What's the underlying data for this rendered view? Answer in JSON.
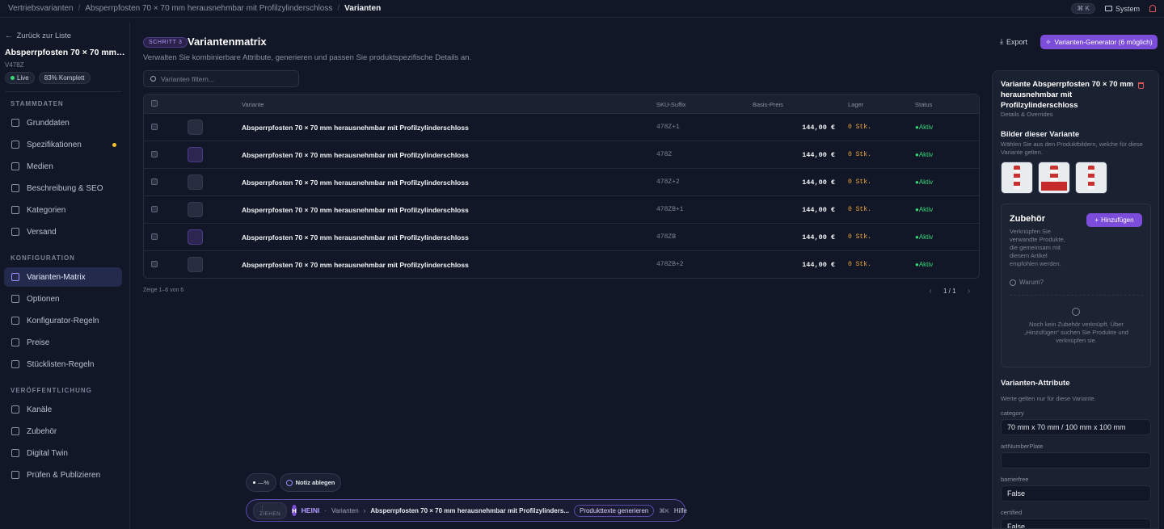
{
  "breadcrumb": {
    "items": [
      "Vertriebsvarianten",
      "Absperrpfosten 70 × 70 mm herausnehmbar mit Profilzylinderschloss",
      "Varianten"
    ]
  },
  "topbar": {
    "shortcut": "⌘ K",
    "theme_label": "System"
  },
  "sidebar": {
    "back_label": "Zurück zur Liste",
    "product_name": "Absperrpfosten 70 × 70 mm he...",
    "sku": "V478Z",
    "status_label": "Live",
    "complete_label": "83% Komplett",
    "sections": [
      {
        "title": "STAMMDATEN",
        "items": [
          "Grunddaten",
          "Spezifikationen",
          "Medien",
          "Beschreibung & SEO",
          "Kategorien",
          "Versand"
        ]
      },
      {
        "title": "KONFIGURATION",
        "items": [
          "Varianten-Matrix",
          "Optionen",
          "Konfigurator-Regeln",
          "Preise",
          "Stücklisten-Regeln"
        ]
      },
      {
        "title": "VERÖFFENTLICHUNG",
        "items": [
          "Kanäle",
          "Zubehör",
          "Digital Twin",
          "Prüfen & Publizieren"
        ]
      }
    ]
  },
  "main": {
    "step_label": "SCHRITT 3",
    "title": "Variantenmatrix",
    "subtitle": "Verwalten Sie kombinierbare Attribute, generieren und passen Sie produktspezifische Details an.",
    "export_label": "Export",
    "generator_label": "Varianten-Generator (6 möglich)",
    "filter_placeholder": "Varianten filtern...",
    "table": {
      "headers": {
        "variant": "Variante",
        "sku": "SKU-Suffix",
        "price": "Basis-Preis",
        "stock": "Lager",
        "status": "Status"
      },
      "rows": [
        {
          "name": "Absperrpfosten 70 × 70 mm herausnehmbar mit Profilzylinderschloss",
          "sku": "478Z+1",
          "price": "144,00 €",
          "stock": "0 Stk.",
          "status": "Aktiv"
        },
        {
          "name": "Absperrpfosten 70 × 70 mm herausnehmbar mit Profilzylinderschloss",
          "sku": "478Z",
          "price": "144,00 €",
          "stock": "0 Stk.",
          "status": "Aktiv"
        },
        {
          "name": "Absperrpfosten 70 × 70 mm herausnehmbar mit Profilzylinderschloss",
          "sku": "478Z+2",
          "price": "144,00 €",
          "stock": "0 Stk.",
          "status": "Aktiv"
        },
        {
          "name": "Absperrpfosten 70 × 70 mm herausnehmbar mit Profilzylinderschloss",
          "sku": "478ZB+1",
          "price": "144,00 €",
          "stock": "0 Stk.",
          "status": "Aktiv"
        },
        {
          "name": "Absperrpfosten 70 × 70 mm herausnehmbar mit Profilzylinderschloss",
          "sku": "478ZB",
          "price": "144,00 €",
          "stock": "0 Stk.",
          "status": "Aktiv"
        },
        {
          "name": "Absperrpfosten 70 × 70 mm herausnehmbar mit Profilzylinderschloss",
          "sku": "478ZB+2",
          "price": "144,00 €",
          "stock": "0 Stk.",
          "status": "Aktiv"
        }
      ]
    },
    "count_label": "Zeige 1–6 von 6",
    "page_label": "1 / 1"
  },
  "panel": {
    "title": "Variante Absperrpfosten 70 × 70 mm herausnehmbar mit Profilzylinderschloss",
    "subtitle": "Details & Overrides",
    "images_heading": "Bilder dieser Variante",
    "images_note": "Wählen Sie aus den Produktbildern, welche für diese Variante gelten.",
    "accessory": {
      "title": "Zubehör",
      "add_label": "Hinzufügen",
      "description": "Verknüpfen Sie verwandte Produkte, die gemeinsam mit diesem Artikel empfohlen werden.",
      "why_label": "Warum?",
      "empty_text": "Noch kein Zubehör verknüpft. Über „Hinzufügen“ suchen Sie Produkte und verknüpfen sie."
    },
    "attributes_heading": "Varianten-Attribute",
    "attributes_note": "Werte gelten nur für diese Variante.",
    "attributes": [
      {
        "label": "category",
        "value": "70 mm x 70 mm / 100 mm x 100 mm"
      },
      {
        "label": "artNumberPlate",
        "value": ""
      },
      {
        "label": "barrierfree",
        "value": "False"
      },
      {
        "label": "certified",
        "value": "False"
      }
    ]
  },
  "bottom": {
    "mini_label": "—%",
    "note_label": "Notiz ablegen",
    "drag_label": "ZIEHEN",
    "avatar_letter": "H",
    "assistant_name": "HEINI",
    "context_section": "Varianten",
    "context_product": "Absperrpfosten 70 × 70 mm herausnehmbar mit Profilzylinders...",
    "action_label": "Produkttexte generieren",
    "shortcut": "⌘K",
    "help_label": "Hilfe"
  },
  "colors": {
    "accent": "#7c4ddb",
    "success": "#37d67a",
    "warning": "#f0a53a",
    "danger": "#e05555",
    "background": "#111726"
  }
}
